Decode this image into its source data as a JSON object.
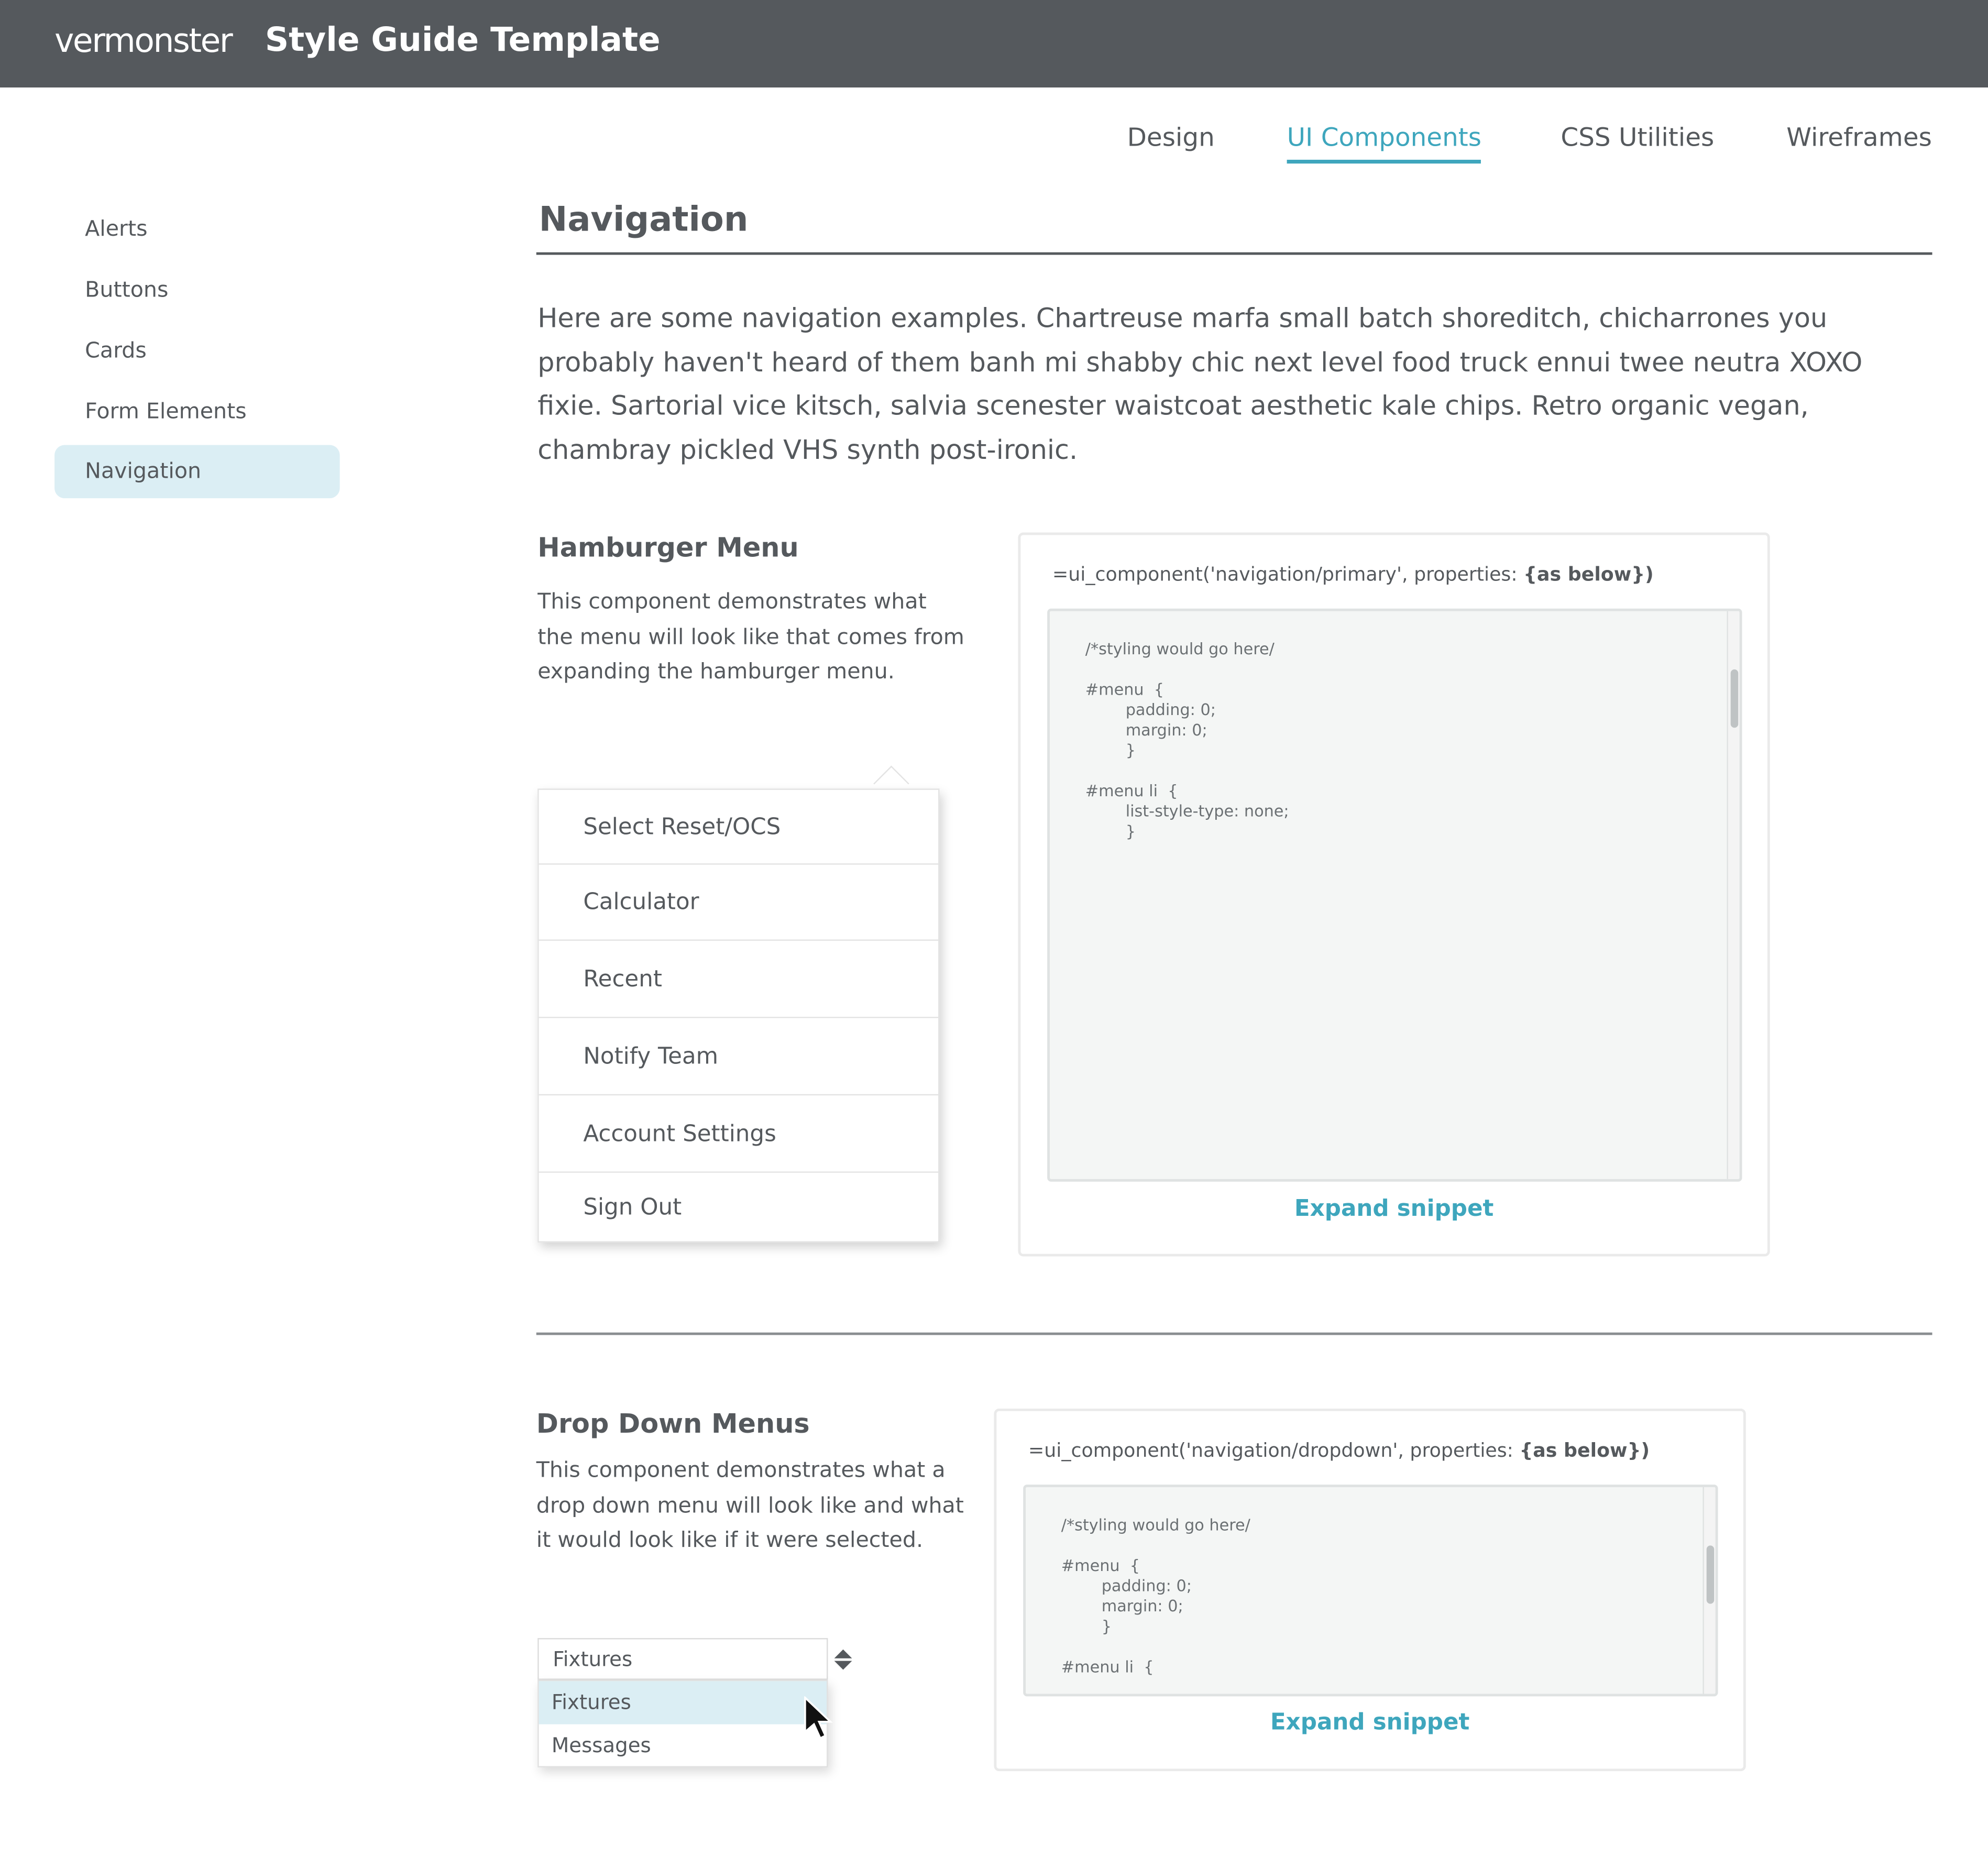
{
  "header": {
    "logo": "vermonster",
    "title": "Style Guide Template"
  },
  "tabs": [
    {
      "label": "Design",
      "active": false
    },
    {
      "label": "UI Components",
      "active": true
    },
    {
      "label": "CSS Utilities",
      "active": false
    },
    {
      "label": "Wireframes",
      "active": false
    }
  ],
  "sidebar": {
    "items": [
      {
        "label": "Alerts",
        "active": false
      },
      {
        "label": "Buttons",
        "active": false
      },
      {
        "label": "Cards",
        "active": false
      },
      {
        "label": "Form Elements",
        "active": false
      },
      {
        "label": "Navigation",
        "active": true
      }
    ]
  },
  "main": {
    "title": "Navigation",
    "intro": "Here are some navigation examples. Chartreuse marfa small batch shoreditch, chicharrones you probably haven't heard of them banh mi shabby chic next level food truck ennui twee neutra XOXO fixie. Sartorial vice kitsch, salvia scenester waistcoat aesthetic kale chips. Retro organic vegan, chambray pickled VHS synth post-ironic."
  },
  "hamburger": {
    "title": "Hamburger Menu",
    "description": "This component demonstrates what the menu will look like that comes from expanding the hamburger menu.",
    "menu_items": [
      "Select Reset/OCS",
      "Calculator",
      "Recent",
      "Notify Team",
      "Account Settings",
      "Sign Out"
    ],
    "snippet_call": "=ui_component('navigation/primary', properties: ",
    "snippet_props": "{as below})",
    "code": "/*styling would go here/\n\n#menu  {\n        padding: 0;\n        margin: 0;\n        }\n\n#menu li  {\n        list-style-type: none;\n        }",
    "expand_label": "Expand snippet"
  },
  "dropdown": {
    "title": "Drop Down Menus",
    "description": "This component demonstrates what a drop down menu will look like and what it would look like if it were selected.",
    "selected_value": "Fixtures",
    "options": [
      "Fixtures",
      "Messages"
    ],
    "highlighted_option": "Fixtures",
    "snippet_call": "=ui_component('navigation/dropdown', properties: ",
    "snippet_props": "{as below})",
    "code": "/*styling would go here/\n\n#menu  {\n        padding: 0;\n        margin: 0;\n        }\n\n#menu li  {",
    "expand_label": "Expand snippet"
  },
  "colors": {
    "header_bg": "#55595d",
    "accent": "#3ea6bd",
    "active_bg": "#dbeef4",
    "text": "#55595d",
    "code_bg": "#f4f6f5"
  },
  "icons": {
    "sort": "sort-arrows-icon",
    "cursor": "mouse-pointer-icon",
    "menu_caret": "caret-up-icon"
  }
}
